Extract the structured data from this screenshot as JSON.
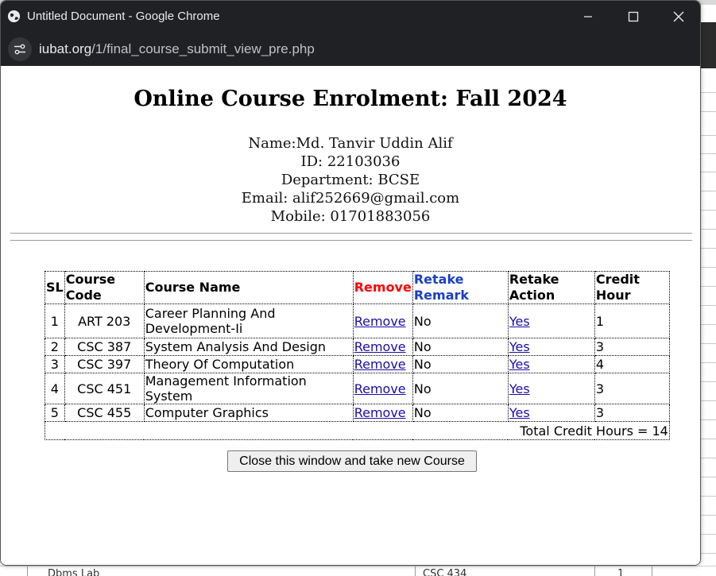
{
  "window": {
    "title": "Untitled Document - Google Chrome",
    "url_host": "iubat.org",
    "url_path": "/1/final_course_submit_view_pre.php"
  },
  "page": {
    "heading": "Online Course Enrolment: Fall 2024",
    "student": {
      "name": "Name:Md. Tanvir Uddin Alif",
      "id": "ID: 22103036",
      "department": "Department: BCSE",
      "email": "Email: alif252669@gmail.com",
      "mobile": "Mobile: 01701883056"
    }
  },
  "table": {
    "headers": {
      "sl": "SL",
      "code_1": "Course",
      "code_2": "Code",
      "name": "Course Name",
      "remove": "Remove",
      "retake_remark_1": "Retake",
      "retake_remark_2": "Remark",
      "retake_action_1": "Retake",
      "retake_action_2": "Action",
      "credit_1": "Credit",
      "credit_2": "Hour"
    },
    "rows": [
      {
        "sl": "1",
        "code": "ART 203",
        "name_1": "Career Planning And",
        "name_2": "Development-Ii",
        "remove": "Remove",
        "remark": "No",
        "action": "Yes",
        "credit": "1"
      },
      {
        "sl": "2",
        "code": "CSC 387",
        "name": "System Analysis And Design",
        "remove": "Remove",
        "remark": "No",
        "action": "Yes",
        "credit": "3"
      },
      {
        "sl": "3",
        "code": "CSC 397",
        "name": "Theory Of Computation",
        "remove": "Remove",
        "remark": "No",
        "action": "Yes",
        "credit": "4"
      },
      {
        "sl": "4",
        "code": "CSC 451",
        "name": "Management Information System",
        "remove": "Remove",
        "remark": "No",
        "action": "Yes",
        "credit": "3"
      },
      {
        "sl": "5",
        "code": "CSC 455",
        "name": "Computer Graphics",
        "remove": "Remove",
        "remark": "No",
        "action": "Yes",
        "credit": "3"
      }
    ],
    "total": "Total Credit Hours = 14"
  },
  "close_button_label": "Close this window and take new Course",
  "background": {
    "bottom_left_text": "Dbms Lab",
    "bottom_mid_text": "CSC 434",
    "bottom_right_text": "1"
  },
  "colors": {
    "remove_header": "#ff0000",
    "retake_remark_header": "#1a3fc4",
    "link": "#1a0dab",
    "titlebar": "#202124"
  }
}
